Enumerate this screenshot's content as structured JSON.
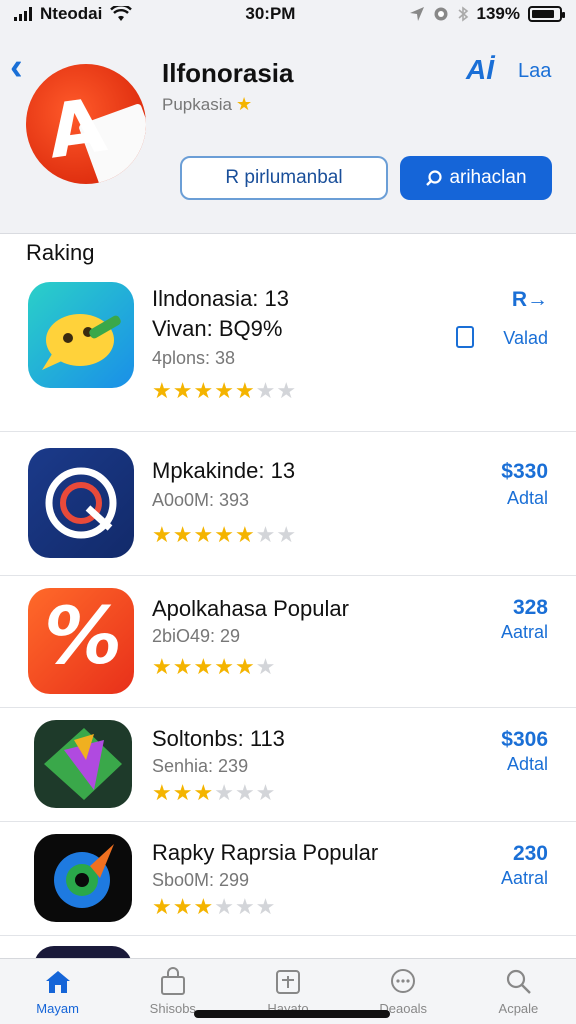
{
  "status_bar": {
    "carrier": "Nteodai",
    "time": "30:PM",
    "battery_percent": "139%",
    "battery_level": 0.85
  },
  "header": {
    "title": "Ilfonorasia",
    "subtitle": "Pupkasia",
    "translate_label": "Aİ",
    "link_label": "Laa",
    "outline_button": "R pirlumanbal",
    "solid_button": "arihaclan"
  },
  "section": {
    "title": "Raking"
  },
  "rows": [
    {
      "title": "Ilndonasia: 13",
      "subtitle2": "Vivan: BQ9%",
      "subtitle": "4plons: 38",
      "rating": 5,
      "rating_max": 7,
      "price": "R→",
      "action": "Valad"
    },
    {
      "title": "Mpkakinde: 13",
      "subtitle": "A0o0M: 393",
      "rating": 5,
      "rating_max": 7,
      "price": "$330",
      "action": "Adtal"
    },
    {
      "title": "Apolkahasa Popular",
      "subtitle": "2biO49: 29",
      "rating": 5,
      "rating_max": 6,
      "price": "328",
      "action": "Aatral"
    },
    {
      "title": "Soltonbs: 113",
      "subtitle": "Senhia: 239",
      "rating": 3,
      "rating_max": 6,
      "price": "$306",
      "action": "Adtal"
    },
    {
      "title": "Rapky Raprsia Popular",
      "subtitle": "Sbo0M: 299",
      "rating": 3,
      "rating_max": 6,
      "price": "230",
      "action": "Aatral"
    }
  ],
  "tabs": [
    {
      "label": "Mayam",
      "icon": "home-icon",
      "active": true
    },
    {
      "label": "Shisobs",
      "icon": "bag-icon",
      "active": false
    },
    {
      "label": "Hayato",
      "icon": "plus-box-icon",
      "active": false
    },
    {
      "label": "Deaoals",
      "icon": "chat-icon",
      "active": false
    },
    {
      "label": "Acpale",
      "icon": "search-icon",
      "active": false
    }
  ],
  "colors": {
    "accent": "#1565d8",
    "star": "#f4b400",
    "header_bg": "#f1f2f5"
  }
}
